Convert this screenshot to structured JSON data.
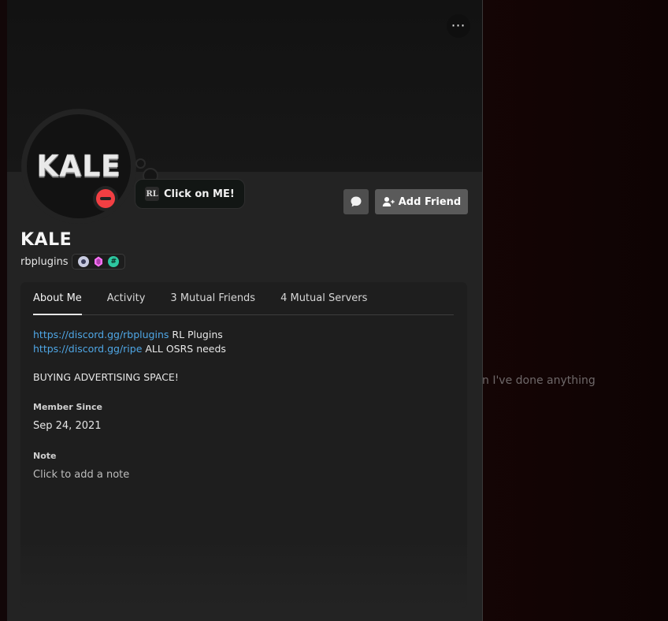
{
  "background": {
    "chat_text": "n I've done anything"
  },
  "profile": {
    "display_name": "KALE",
    "username": "rbplugins",
    "avatar_text": "KALE",
    "status": "do-not-disturb",
    "custom_status": {
      "logo": "RL",
      "text": "Click on ME!"
    },
    "more_icon": "more-horizontal-icon",
    "more_label": "⋯",
    "actions": {
      "message_icon": "message-bubble-icon",
      "add_friend_label": "Add Friend",
      "add_friend_icon": "add-user-icon"
    },
    "badges": [
      "nitro-badge",
      "boost-badge",
      "hashtag-badge"
    ],
    "badge_hash_label": "#"
  },
  "tabs": [
    {
      "label": "About Me",
      "active": true
    },
    {
      "label": "Activity",
      "active": false
    },
    {
      "label": "3 Mutual Friends",
      "active": false
    },
    {
      "label": "4 Mutual Servers",
      "active": false
    }
  ],
  "about_me": {
    "line1_link": "https://discord.gg/rbplugins",
    "line1_text": " RL Plugins",
    "line2_link": "https://discord.gg/ripe",
    "line2_text": " ALL OSRS needs",
    "line3": "BUYING ADVERTISING SPACE!"
  },
  "member_since": {
    "title": "Member Since",
    "value": "Sep 24, 2021"
  },
  "note": {
    "title": "Note",
    "placeholder": "Click to add a note"
  },
  "colors": {
    "accent_link": "#4fa7e6",
    "dnd_red": "#f23f43",
    "card_bg": "#1e1e1e",
    "panel_bg": "#232323"
  }
}
